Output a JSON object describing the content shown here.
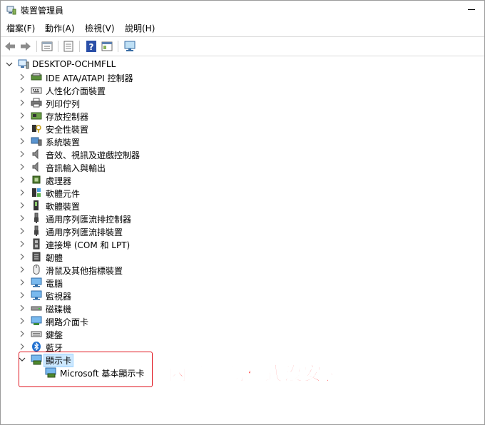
{
  "window": {
    "title": "裝置管理員"
  },
  "menu": [
    "檔案(F)",
    "動作(A)",
    "檢視(V)",
    "說明(H)"
  ],
  "toolbar": [
    "back-arrow-icon",
    "forward-arrow-icon",
    "properties-icon",
    "view-icon",
    "help-icon",
    "console-icon",
    "monitor-scan-icon"
  ],
  "tree": {
    "root": "DESKTOP-OCHMFLL",
    "items": [
      {
        "label": "IDE ATA/ATAPI 控制器",
        "icon": "ide-controller-icon"
      },
      {
        "label": "人性化介面裝置",
        "icon": "hid-icon"
      },
      {
        "label": "列印佇列",
        "icon": "printer-icon"
      },
      {
        "label": "存放控制器",
        "icon": "storage-controller-icon"
      },
      {
        "label": "安全性裝置",
        "icon": "security-device-icon"
      },
      {
        "label": "系統裝置",
        "icon": "system-device-icon"
      },
      {
        "label": "音效、視訊及遊戲控制器",
        "icon": "speaker-icon"
      },
      {
        "label": "音訊輸入與輸出",
        "icon": "audio-io-icon"
      },
      {
        "label": "處理器",
        "icon": "processor-icon"
      },
      {
        "label": "軟體元件",
        "icon": "software-component-icon"
      },
      {
        "label": "軟體裝置",
        "icon": "software-device-icon"
      },
      {
        "label": "通用序列匯流排控制器",
        "icon": "usb-icon"
      },
      {
        "label": "通用序列匯流排裝置",
        "icon": "usb-device-icon"
      },
      {
        "label": "連接埠 (COM 和 LPT)",
        "icon": "port-icon"
      },
      {
        "label": "韌體",
        "icon": "firmware-icon"
      },
      {
        "label": "滑鼠及其他指標裝置",
        "icon": "mouse-icon"
      },
      {
        "label": "電腦",
        "icon": "computer-icon"
      },
      {
        "label": "監視器",
        "icon": "monitor-icon"
      },
      {
        "label": "磁碟機",
        "icon": "disk-drive-icon"
      },
      {
        "label": "網路介面卡",
        "icon": "network-adapter-icon"
      },
      {
        "label": "鍵盤",
        "icon": "keyboard-icon"
      },
      {
        "label": "藍牙",
        "icon": "bluetooth-icon"
      }
    ],
    "display": {
      "label": "顯示卡",
      "child": "Microsoft 基本顯示卡"
    }
  },
  "annotation": "內顯驅動程式沒安裝",
  "colors": {
    "annotation": "#ff1111",
    "box": "#e0141e",
    "selection": "#cce8ff"
  }
}
